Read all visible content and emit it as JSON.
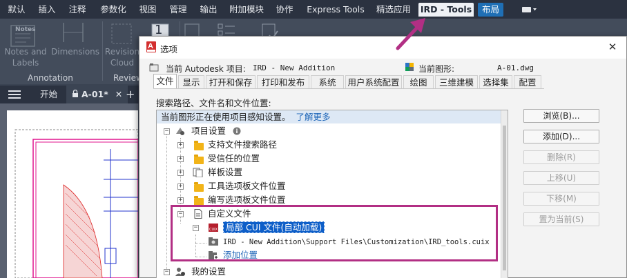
{
  "ribbon_tabs": [
    {
      "label": "默认"
    },
    {
      "label": "插入"
    },
    {
      "label": "注释"
    },
    {
      "label": "参数化"
    },
    {
      "label": "视图"
    },
    {
      "label": "管理"
    },
    {
      "label": "输出"
    },
    {
      "label": "附加模块"
    },
    {
      "label": "协作"
    },
    {
      "label": "Express Tools"
    },
    {
      "label": "精选应用"
    },
    {
      "label": "IRD - Tools",
      "active": true
    },
    {
      "label": "布局",
      "highlighted": true
    }
  ],
  "ribbon": {
    "notes_label": "Notes",
    "buttons": [
      "Notes and\nLabels",
      "Dimensions",
      "Revision\nCloud",
      "Revie"
    ],
    "panels": [
      "Annotation",
      "Review"
    ],
    "big_number": "1"
  },
  "file_tabs": {
    "start": "开始",
    "drawing": "A-01*"
  },
  "dialog": {
    "title": "选项",
    "project_label": "当前 Autodesk 项目:",
    "project_value": "IRD - New Addition",
    "drawing_label": "当前图形:",
    "drawing_value": "A-01.dwg",
    "tabs": [
      {
        "label": "文件",
        "active": true
      },
      {
        "label": "显示"
      },
      {
        "label": "打开和保存"
      },
      {
        "label": "打印和发布"
      },
      {
        "label": "系统"
      },
      {
        "label": "用户系统配置"
      },
      {
        "label": "绘图"
      },
      {
        "label": "三维建模"
      },
      {
        "label": "选择集"
      },
      {
        "label": "配置"
      }
    ],
    "search_label": "搜索路径、文件名和文件位置:",
    "notice": "当前图形正在使用项目感知设置。",
    "notice_link": "了解更多",
    "tree": {
      "project_settings": "项目设置",
      "support_paths": "支持文件搜索路径",
      "trusted": "受信任的位置",
      "templates": "样板设置",
      "tool_palettes": "工具选项板文件位置",
      "authoring": "编写选项板文件位置",
      "custom_files": "自定义文件",
      "local_cui": "局部 CUI 文件(自动加载)",
      "cui_path": "IRD - New Addition\\Support Files\\Customization\\IRD_tools.cuix",
      "add_location": "添加位置",
      "my_settings": "我的设置"
    },
    "buttons": [
      {
        "label": "浏览(B)...",
        "enabled": true
      },
      {
        "label": "添加(D)...",
        "enabled": true
      },
      {
        "label": "删除(R)",
        "enabled": false
      },
      {
        "label": "上移(U)",
        "enabled": false
      },
      {
        "label": "下移(M)",
        "enabled": false
      },
      {
        "label": "置为当前(S)",
        "enabled": false
      }
    ]
  },
  "colors": {
    "accent": "#1f6fb5",
    "annotation": "#b22f84",
    "selection": "#0d5ec8"
  }
}
